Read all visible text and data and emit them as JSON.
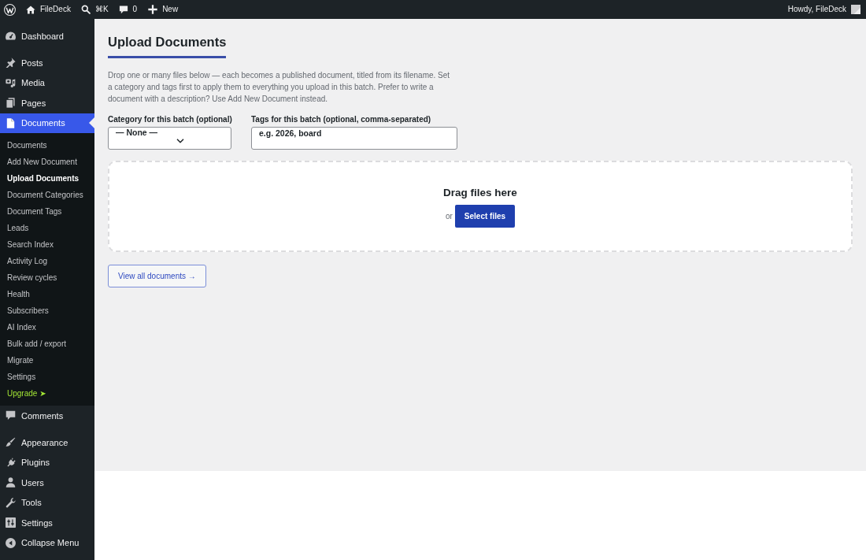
{
  "admin_bar": {
    "site_name": "FileDeck",
    "search_shortcut": "⌘K",
    "comments_count": "0",
    "new_label": "New",
    "greeting": "Howdy, FileDeck"
  },
  "sidebar": {
    "groups": [
      {
        "items": [
          {
            "label": "Dashboard",
            "selected": false
          }
        ]
      },
      {
        "items": [
          {
            "label": "Posts",
            "selected": false
          },
          {
            "label": "Media",
            "selected": false
          },
          {
            "label": "Pages",
            "selected": false
          },
          {
            "label": "Documents",
            "selected": true,
            "children": [
              {
                "label": "Documents",
                "kind": "link",
                "selected": false
              },
              {
                "label": "Add New Document",
                "kind": "link",
                "selected": false
              },
              {
                "label": "Upload Documents",
                "kind": "link",
                "selected": true
              },
              {
                "label": "Document Categories",
                "kind": "link",
                "selected": false
              },
              {
                "label": "Document Tags",
                "kind": "link",
                "selected": false
              },
              {
                "label": "Leads",
                "kind": "link",
                "selected": false
              },
              {
                "label": "Search Index",
                "kind": "link",
                "selected": false
              },
              {
                "label": "Activity Log",
                "kind": "link",
                "selected": false
              },
              {
                "label": "Review cycles",
                "kind": "link",
                "selected": false
              },
              {
                "label": "Health",
                "kind": "link",
                "selected": false
              },
              {
                "label": "Subscribers",
                "kind": "link",
                "selected": false
              },
              {
                "label": "AI Index",
                "kind": "link",
                "selected": false
              },
              {
                "label": "Bulk add / export",
                "kind": "link",
                "selected": false
              },
              {
                "label": "Migrate",
                "kind": "link",
                "selected": false
              },
              {
                "label": "Settings",
                "kind": "link",
                "selected": false
              },
              {
                "label": "Upgrade ➤",
                "kind": "upgrade",
                "selected": false
              }
            ]
          },
          {
            "label": "Comments",
            "selected": false
          }
        ]
      },
      {
        "items": [
          {
            "label": "Appearance",
            "selected": false
          },
          {
            "label": "Plugins",
            "selected": false
          },
          {
            "label": "Users",
            "selected": false
          },
          {
            "label": "Tools",
            "selected": false
          },
          {
            "label": "Settings",
            "selected": false
          }
        ]
      }
    ],
    "collapse_label": "Collapse Menu"
  },
  "page": {
    "title": "Upload Documents",
    "description": "Drop one or many files below — each becomes a published document, titled from its filename. Set a category and tags first to apply them to everything you upload in this batch. Prefer to write a document with a description? Use Add New Document instead.",
    "category_field": {
      "label": "Category for this batch (optional)",
      "value": "— None —"
    },
    "tags_field": {
      "label": "Tags for this batch (optional, comma-separated)",
      "placeholder": "e.g. 2026, board"
    },
    "dropzone": {
      "heading": "Drag files here",
      "or_text": "or",
      "button": "Select files"
    },
    "view_all_button": "View all documents →"
  }
}
